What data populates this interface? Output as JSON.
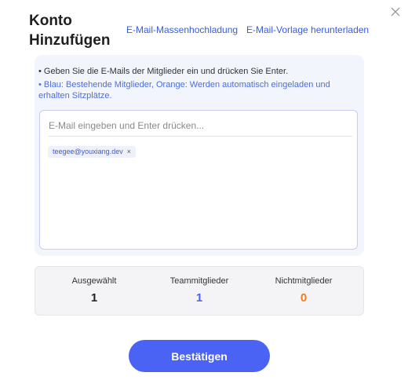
{
  "dialog": {
    "title": "Konto Hinzufügen",
    "bulk_upload_link": "E-Mail-Massenhochladung",
    "template_download_link": "E-Mail-Vorlage herunterladen"
  },
  "instructions": {
    "line1": "• Geben Sie die E-Mails der Mitglieder ein und drücken Sie Enter.",
    "line2": "• Blau: Bestehende Mitglieder, Orange: Werden automatisch eingeladen und erhalten Sitzplätze."
  },
  "email_input": {
    "placeholder": "E-Mail eingeben und Enter drücken...",
    "value": ""
  },
  "tags": [
    {
      "email": "teegee@youxiang.dev",
      "remove_glyph": "×",
      "color": "#3f5bd4"
    }
  ],
  "stats": {
    "selected": {
      "label": "Ausgewählt",
      "value": "1",
      "color": "#222222"
    },
    "team_members": {
      "label": "Teammitglieder",
      "value": "1",
      "color": "#4a63f5"
    },
    "non_members": {
      "label": "Nichtmitglieder",
      "value": "0",
      "color": "#f07a1e"
    }
  },
  "confirm_button": {
    "label": "Bestätigen",
    "color": "#4a63f5"
  },
  "icons": {
    "close": "close-icon",
    "tag_remove": "close-icon"
  }
}
